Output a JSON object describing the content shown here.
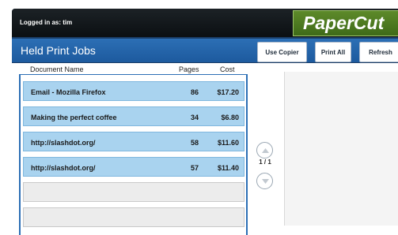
{
  "header": {
    "login_text": "Logged in as: tim",
    "logo_text": "PaperCut"
  },
  "toolbar": {
    "title": "Held Print Jobs",
    "use_copier_label": "Use Copier",
    "print_all_label": "Print All",
    "refresh_label": "Refresh"
  },
  "table": {
    "columns": [
      "Document Name",
      "Pages",
      "Cost"
    ],
    "rows": [
      {
        "document": "Email - Mozilla Firefox",
        "pages": "86",
        "cost": "$17.20"
      },
      {
        "document": "Making the perfect coffee",
        "pages": "34",
        "cost": "$6.80"
      },
      {
        "document": "http://slashdot.org/",
        "pages": "58",
        "cost": "$11.60"
      },
      {
        "document": "http://slashdot.org/",
        "pages": "57",
        "cost": "$11.40"
      }
    ]
  },
  "pager": {
    "label": "1 / 1",
    "up_icon": "chevron-up-icon",
    "down_icon": "chevron-down-icon"
  },
  "colors": {
    "header_blue": "#2c6fb5",
    "row_blue": "#a9d3ef",
    "logo_green": "#4f7c22"
  }
}
